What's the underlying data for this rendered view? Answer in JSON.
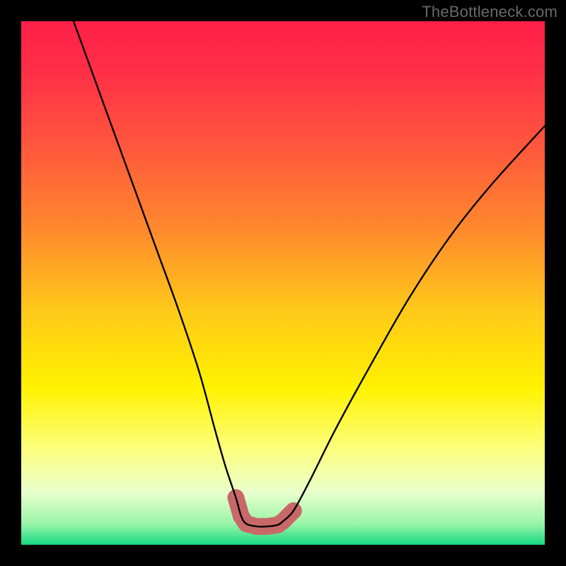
{
  "attribution": "TheBottleneck.com",
  "colors": {
    "frame": "#000000",
    "gradient_stops": [
      {
        "offset": 0.0,
        "color": "#ff1f48"
      },
      {
        "offset": 0.1,
        "color": "#ff3046"
      },
      {
        "offset": 0.25,
        "color": "#ff5a3c"
      },
      {
        "offset": 0.4,
        "color": "#ff8a2c"
      },
      {
        "offset": 0.55,
        "color": "#ffc81a"
      },
      {
        "offset": 0.7,
        "color": "#fff200"
      },
      {
        "offset": 0.82,
        "color": "#fcff80"
      },
      {
        "offset": 0.9,
        "color": "#e8ffcc"
      },
      {
        "offset": 0.96,
        "color": "#9af5a8"
      },
      {
        "offset": 1.0,
        "color": "#17d884"
      }
    ],
    "curve": "#000000",
    "marker_fill": "#c96868",
    "marker_stroke": "#c96868"
  },
  "chart_data": {
    "type": "line",
    "title": "",
    "xlabel": "",
    "ylabel": "",
    "xlim": [
      0,
      100
    ],
    "ylim": [
      0,
      100
    ],
    "grid": false,
    "legend": false,
    "series": [
      {
        "name": "bottleneck-curve",
        "x": [
          10,
          14,
          18,
          22,
          26,
          30,
          34,
          37,
          39,
          41,
          42,
          43,
          45,
          47,
          49,
          50,
          52,
          55,
          60,
          66,
          74,
          82,
          90,
          100
        ],
        "y": [
          100,
          89,
          78,
          67,
          56,
          45,
          33,
          22,
          15,
          9,
          5.5,
          4,
          3.5,
          3.5,
          3.8,
          4.5,
          6.5,
          12,
          22,
          33,
          47,
          59,
          69,
          80
        ]
      }
    ],
    "markers": {
      "name": "bottom-cluster",
      "points": [
        {
          "x": 41.0,
          "y": 9.0
        },
        {
          "x": 42.0,
          "y": 5.5
        },
        {
          "x": 43.0,
          "y": 4.0
        },
        {
          "x": 45.0,
          "y": 3.5
        },
        {
          "x": 47.0,
          "y": 3.5
        },
        {
          "x": 49.0,
          "y": 3.8
        },
        {
          "x": 50.0,
          "y": 4.5
        },
        {
          "x": 52.0,
          "y": 6.5
        }
      ],
      "radius_data_units": 1.6
    }
  }
}
